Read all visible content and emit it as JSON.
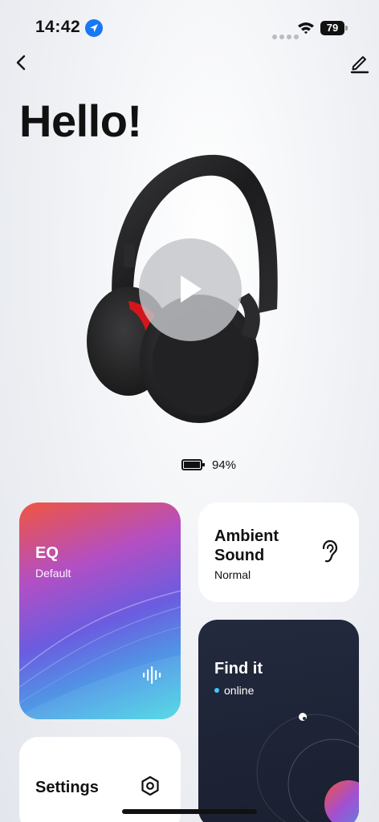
{
  "status_bar": {
    "time": "14:42",
    "battery_level": "79"
  },
  "header": {
    "greeting": "Hello!"
  },
  "device": {
    "battery_percent": "94%"
  },
  "cards": {
    "eq": {
      "title": "EQ",
      "subtitle": "Default"
    },
    "ambient": {
      "title": "Ambient Sound",
      "subtitle": "Normal"
    },
    "find": {
      "title": "Find it",
      "status": "online"
    },
    "settings": {
      "title": "Settings"
    }
  },
  "icons": {
    "back": "chevron-left-icon",
    "edit": "pencil-icon",
    "play": "play-icon",
    "ear": "ear-icon",
    "eq_bars": "sound-wave-icon",
    "settings": "hexagon-gear-icon"
  },
  "colors": {
    "accent_blue": "#1877f2",
    "online_dot": "#3ec8ff",
    "find_card_bg": "#1e2436"
  }
}
